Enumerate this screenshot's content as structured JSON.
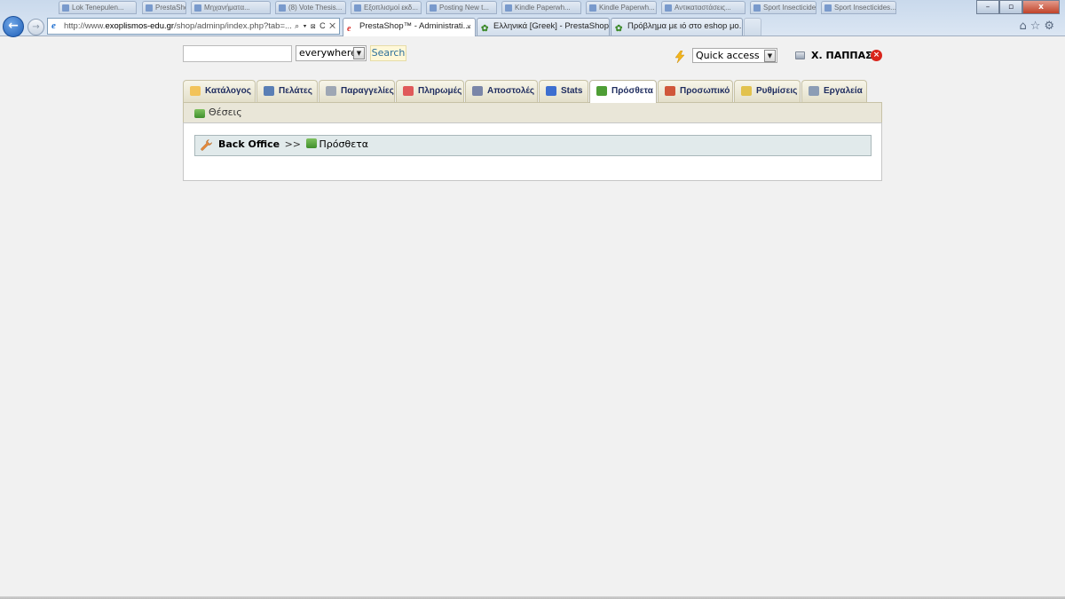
{
  "browser": {
    "background_tabs": [
      "Lok Tenepulen...",
      "PrestaShop™ ...",
      "Μηχανήματα...",
      "(8) Vote Thesis...",
      "Εξοπλισμοί εκδ...",
      "Posting New t...",
      "Kindle Paperwh...",
      "Kindle Paperwh...",
      "Αντικαταστάσεις...",
      "Sport Insecticides...",
      "Sport Insecticides..."
    ],
    "window_controls": {
      "minimize": "–",
      "maximize": "▫",
      "close": "x"
    },
    "back_glyph": "←",
    "forward_glyph": "→",
    "address": {
      "ie_glyph": "e",
      "url_prefix": "http://www.",
      "url_domain": "exoplismos-edu.gr",
      "url_rest": "/shop/adminp/index.php?tab=...",
      "tools": "⌕ ▾ ⊠ C ✕"
    },
    "tabs": [
      {
        "title": "PrestaShop™ - Administrati...",
        "close": "×",
        "fav": "e"
      },
      {
        "title": "Ελληνικά [Greek] - PrestaShop ...",
        "fav": "✿"
      },
      {
        "title": "Πρόβλημα με ιό στο eshop μο...",
        "fav": "✿"
      }
    ],
    "right_icons": "⌂☆⚙"
  },
  "toolbar": {
    "search_placeholder": "",
    "scope_value": "everywhere",
    "search_button": "Search",
    "quick_access": "Quick access",
    "user_name": "Χ. ΠΑΠΠΑΣ",
    "logout_glyph": "×",
    "select_arrow": "▼"
  },
  "colors": {
    "tab_text": "#1f2d5f",
    "breadcrumb_bg": "#e1eaeb",
    "subnav_bg": "#e9e6d8",
    "search_btn_bg": "#fff8d8"
  },
  "main_tabs": [
    {
      "label": "Κατάλογος",
      "icon": "folder-icon",
      "color": "#f2c35a"
    },
    {
      "label": "Πελάτες",
      "icon": "user-icon",
      "color": "#5a7fb5"
    },
    {
      "label": "Παραγγελίες",
      "icon": "cart-icon",
      "color": "#9ea7b4"
    },
    {
      "label": "Πληρωμές",
      "icon": "payment-icon",
      "color": "#e05a5a"
    },
    {
      "label": "Αποστολές",
      "icon": "truck-icon",
      "color": "#7a86a8"
    },
    {
      "label": "Stats",
      "icon": "chart-icon",
      "color": "#3d6fd0"
    },
    {
      "label": "Πρόσθετα",
      "icon": "puzzle-icon",
      "color": "#4e9e35",
      "active": true
    },
    {
      "label": "Προσωπικό",
      "icon": "employee-icon",
      "color": "#d0573a"
    },
    {
      "label": "Ρυθμίσεις",
      "icon": "settings-icon",
      "color": "#e2c24d"
    },
    {
      "label": "Εργαλεία",
      "icon": "tools-icon",
      "color": "#8c9db5"
    }
  ],
  "subnav": {
    "label": "Θέσεις",
    "icon": "positions-icon"
  },
  "breadcrumb": {
    "root": "Back Office",
    "separator": ">>",
    "current": "Πρόσθετα"
  }
}
